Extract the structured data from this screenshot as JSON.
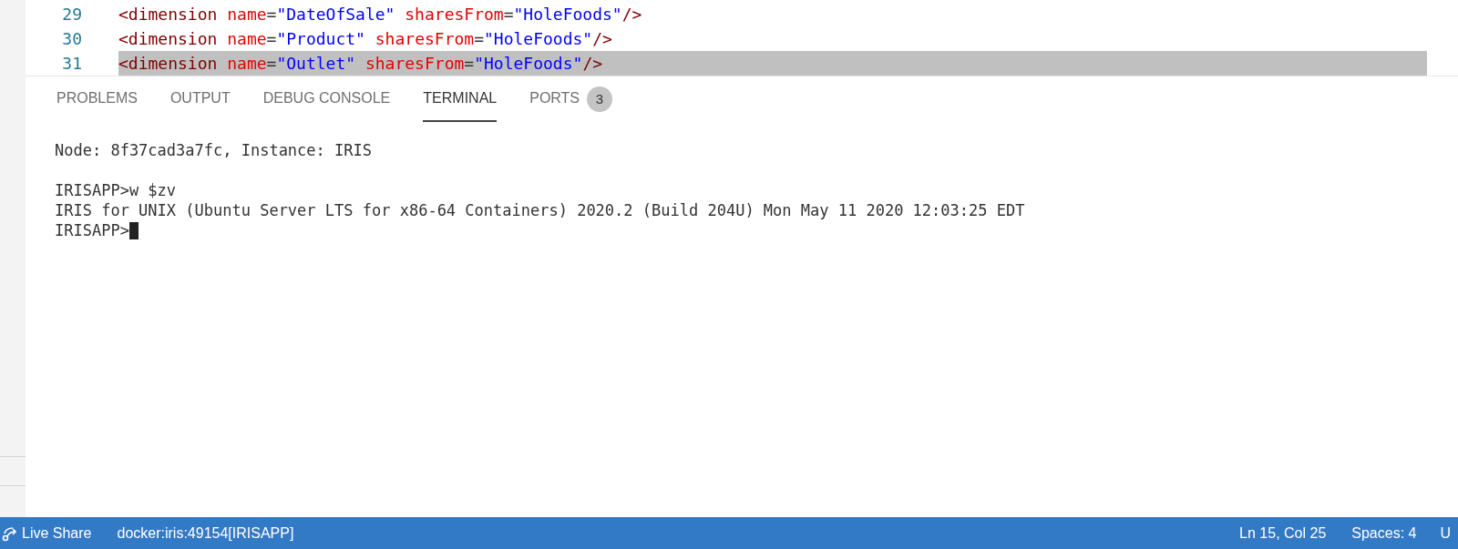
{
  "editor": {
    "lines": [
      {
        "number": "29",
        "selected": false,
        "tokens": [
          {
            "kind": "tag",
            "text": "<dimension"
          },
          {
            "kind": "attr",
            "text": "name"
          },
          {
            "kind": "punct",
            "text": "="
          },
          {
            "kind": "string",
            "text": "\"DateOfSale\""
          },
          {
            "kind": "attr",
            "text": "sharesFrom"
          },
          {
            "kind": "punct",
            "text": "="
          },
          {
            "kind": "string",
            "text": "\"HoleFoods\""
          },
          {
            "kind": "tag",
            "text": "/>"
          }
        ]
      },
      {
        "number": "30",
        "selected": false,
        "tokens": [
          {
            "kind": "tag",
            "text": "<dimension"
          },
          {
            "kind": "attr",
            "text": "name"
          },
          {
            "kind": "punct",
            "text": "="
          },
          {
            "kind": "string",
            "text": "\"Product\""
          },
          {
            "kind": "attr",
            "text": "sharesFrom"
          },
          {
            "kind": "punct",
            "text": "="
          },
          {
            "kind": "string",
            "text": "\"HoleFoods\""
          },
          {
            "kind": "tag",
            "text": "/>"
          }
        ]
      },
      {
        "number": "31",
        "selected": true,
        "tokens": [
          {
            "kind": "tag",
            "text": "<dimension"
          },
          {
            "kind": "attr",
            "text": "name"
          },
          {
            "kind": "punct",
            "text": "="
          },
          {
            "kind": "string",
            "text": "\"Outlet\""
          },
          {
            "kind": "attr",
            "text": "sharesFrom"
          },
          {
            "kind": "punct",
            "text": "="
          },
          {
            "kind": "string",
            "text": "\"HoleFoods\""
          },
          {
            "kind": "tag",
            "text": "/>"
          }
        ]
      }
    ]
  },
  "panel": {
    "tabs": [
      {
        "label": "PROBLEMS",
        "selected": false
      },
      {
        "label": "OUTPUT",
        "selected": false
      },
      {
        "label": "DEBUG CONSOLE",
        "selected": false
      },
      {
        "label": "TERMINAL",
        "selected": true
      },
      {
        "label": "PORTS",
        "selected": false,
        "badge": "3"
      }
    ],
    "terminal": {
      "lines": [
        "Node: 8f37cad3a7fc, Instance: IRIS",
        "IRISAPP>w $zv",
        "IRIS for UNIX (Ubuntu Server LTS for x86-64 Containers) 2020.2 (Build 204U) Mon May 11 2020 12:03:25 EDT"
      ],
      "prompt": "IRISAPP>"
    }
  },
  "status_bar": {
    "left": [
      {
        "label": "Live Share",
        "kind": "live-share"
      },
      {
        "label": "docker:iris:49154[IRISAPP]",
        "kind": "text"
      }
    ],
    "right": [
      {
        "label": "Ln 15, Col 25"
      },
      {
        "label": "Spaces: 4"
      },
      {
        "label": "U"
      }
    ]
  }
}
